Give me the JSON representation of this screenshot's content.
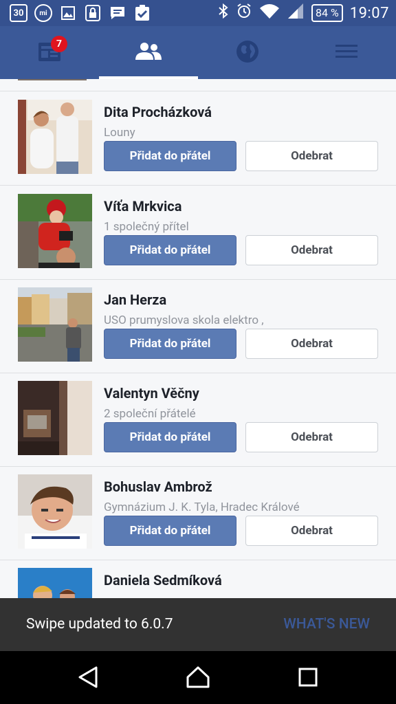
{
  "status_bar": {
    "left_icons": [
      {
        "name": "calendar-icon",
        "label": "30"
      },
      {
        "name": "mi-app-icon",
        "label": "mi"
      },
      {
        "name": "image-icon",
        "label": ""
      },
      {
        "name": "lock-icon",
        "label": ""
      },
      {
        "name": "message-icon",
        "label": ""
      },
      {
        "name": "clipboard-check-icon",
        "label": ""
      }
    ],
    "battery": "84 %",
    "time": "19:07"
  },
  "nav": {
    "feed_badge": "7",
    "tabs": [
      "news-feed",
      "friend-requests",
      "notifications",
      "menu"
    ],
    "active_tab": "friend-requests"
  },
  "people": [
    {
      "name": "Dita Procházková",
      "subtitle": "Louny"
    },
    {
      "name": "Víťa Mrkvica",
      "subtitle": "1 společný přítel"
    },
    {
      "name": "Jan Herza",
      "subtitle": "USO prumyslova skola elektro ,"
    },
    {
      "name": "Valentyn Věčny",
      "subtitle": "2 společní přátelé"
    },
    {
      "name": "Bohuslav Ambrož",
      "subtitle": "Gymnázium J. K. Tyla, Hradec Králové"
    },
    {
      "name": "Daniela Sedmíková",
      "subtitle": ""
    }
  ],
  "buttons": {
    "add": "Přidat do přátel",
    "remove": "Odebrat"
  },
  "snackbar": {
    "message": "Swipe updated to 6.0.7",
    "action": "WHAT'S NEW"
  },
  "colors": {
    "brand": "#3b5998",
    "button": "#5b7bb4",
    "badge": "#e0141e"
  }
}
